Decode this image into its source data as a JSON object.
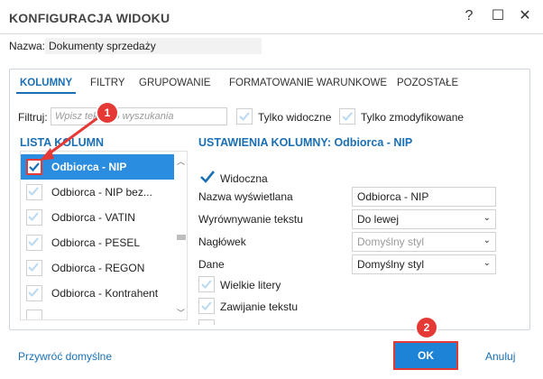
{
  "window": {
    "title": "KONFIGURACJA WIDOKU",
    "help_glyph": "?",
    "maximize_glyph": "☐",
    "close_glyph": "✕"
  },
  "name_row": {
    "label": "Nazwa:",
    "value": "Dokumenty sprzedaży"
  },
  "tabs": [
    {
      "label": "KOLUMNY",
      "active": true
    },
    {
      "label": "FILTRY"
    },
    {
      "label": "GRUPOWANIE"
    },
    {
      "label": "FORMATOWANIE WARUNKOWE"
    },
    {
      "label": "POZOSTAŁE"
    }
  ],
  "filter": {
    "label": "Filtruj:",
    "placeholder": "Wpisz tekst do wyszukania",
    "only_visible_label": "Tylko widoczne",
    "only_modified_label": "Tylko zmodyfikowane"
  },
  "column_list": {
    "title": "LISTA KOLUMN",
    "items": [
      {
        "label": "Odbiorca - NIP",
        "checked": true,
        "selected": true
      },
      {
        "label": "Odbiorca - NIP bez...",
        "checked": false
      },
      {
        "label": "Odbiorca - VATIN",
        "checked": false
      },
      {
        "label": "Odbiorca - PESEL",
        "checked": false
      },
      {
        "label": "Odbiorca - REGON",
        "checked": false
      },
      {
        "label": "Odbiorca - Kontrahent",
        "checked": false
      }
    ]
  },
  "settings": {
    "title": "USTAWIENIA KOLUMNY: Odbiorca - NIP",
    "visible_label": "Widoczna",
    "display_name_label": "Nazwa wyświetlana",
    "display_name_value": "Odbiorca - NIP",
    "align_label": "Wyrównywanie tekstu",
    "align_value": "Do lewej",
    "header_label": "Nagłówek",
    "header_value": "Domyślny styl",
    "data_label": "Dane",
    "data_value": "Domyślny styl",
    "uppercase_label": "Wielkie litery",
    "wrap_label": "Zawijanie tekstu"
  },
  "footer": {
    "restore_label": "Przywróć domyślne",
    "ok_label": "OK",
    "cancel_label": "Anuluj"
  },
  "annotations": {
    "badge1": "1",
    "badge2": "2"
  },
  "colors": {
    "accent": "#1a6fb5",
    "selection": "#2a8de0",
    "ok_button": "#1c83d6",
    "highlight": "#e53935"
  }
}
